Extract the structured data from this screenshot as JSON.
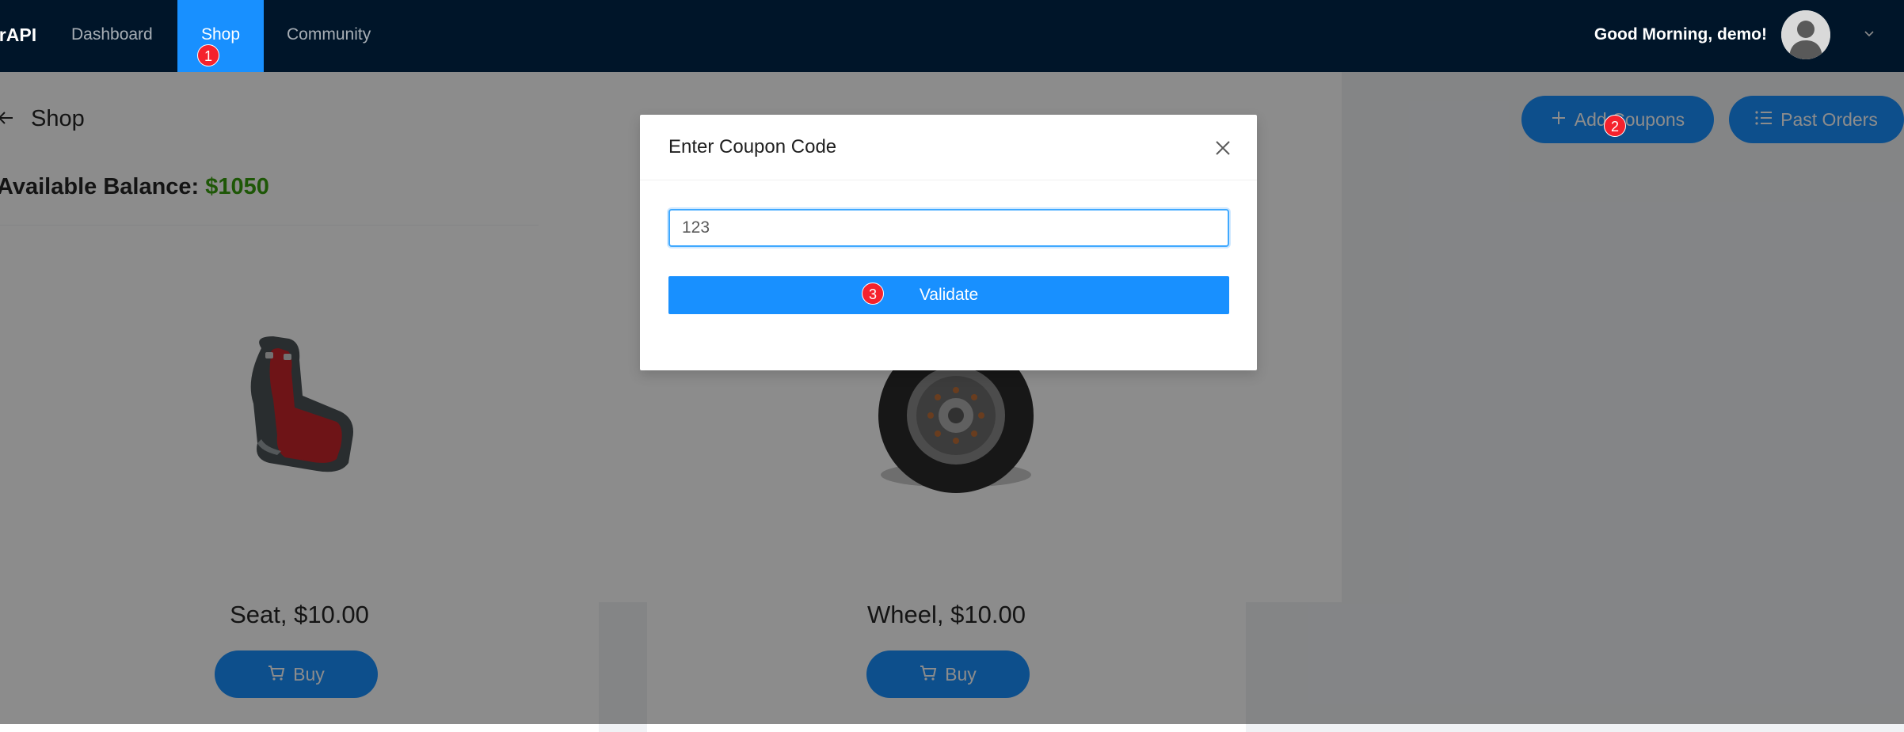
{
  "navbar": {
    "brand": "crAPI",
    "items": [
      {
        "label": "Dashboard"
      },
      {
        "label": "Shop"
      },
      {
        "label": "Community"
      }
    ],
    "greeting": "Good Morning, demo!",
    "avatar_icon": "user-avatar-icon",
    "menu_icon": "chevron-down-icon"
  },
  "page": {
    "title": "Shop",
    "balance_label": "Available Balance:",
    "balance_value": "$1050",
    "actions": {
      "add_coupons": "Add Coupons",
      "past_orders": "Past Orders"
    }
  },
  "products": [
    {
      "name": "Seat, $10.00",
      "buy_label": "Buy",
      "image_icon": "car-seat-image"
    },
    {
      "name": "Wheel, $10.00",
      "buy_label": "Buy",
      "image_icon": "wheel-image"
    }
  ],
  "modal": {
    "title": "Enter Coupon Code",
    "input_value": "123",
    "submit_label": "Validate",
    "close_icon": "close-icon"
  },
  "markers": [
    "1",
    "2",
    "3"
  ],
  "colors": {
    "nav_bg": "#001529",
    "primary": "#1890ff",
    "balance": "#389e0d",
    "marker": "#f5222d"
  }
}
